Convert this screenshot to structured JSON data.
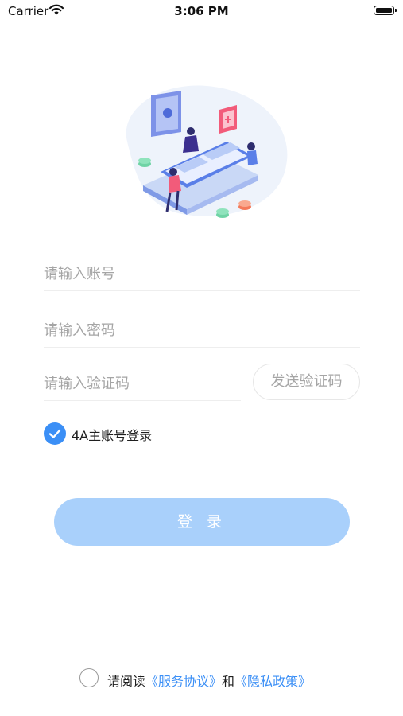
{
  "status_bar": {
    "carrier": "Carrier",
    "time": "3:06 PM"
  },
  "form": {
    "account_placeholder": "请输入账号",
    "password_placeholder": "请输入密码",
    "code_placeholder": "请输入验证码",
    "send_code_label": "发送验证码",
    "main_account_label": "4A主账号登录",
    "main_account_checked": true
  },
  "login_button": {
    "label": "登 录"
  },
  "agreement": {
    "prefix": "请阅读",
    "service_link": "《服务协议》",
    "connector": "和",
    "privacy_link": "《隐私政策》",
    "checked": false
  },
  "colors": {
    "accent": "#3b8ff6",
    "button_bg": "#a9d0fb",
    "placeholder": "#a5a5a5"
  }
}
